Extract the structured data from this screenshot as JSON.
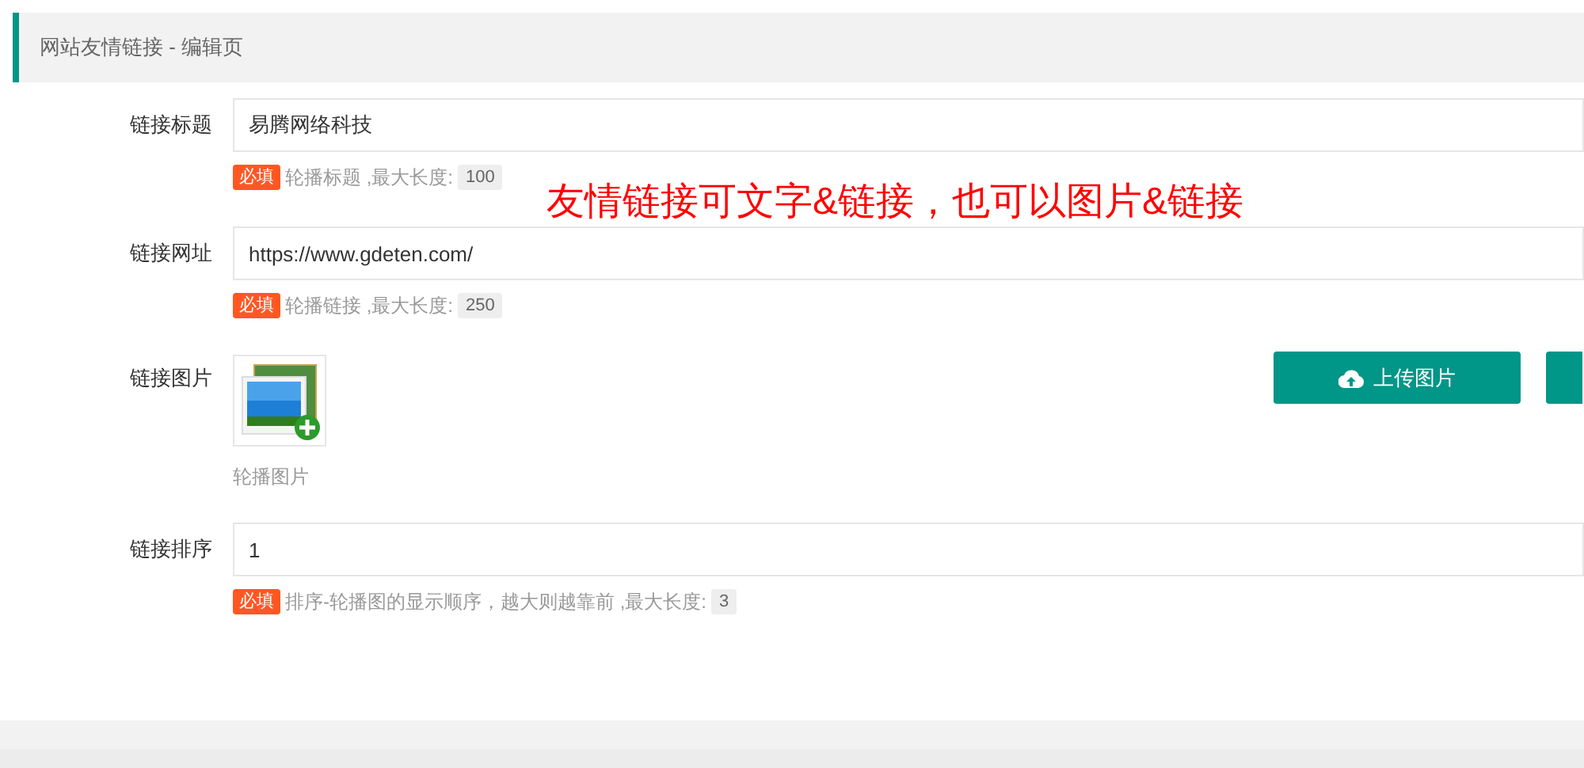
{
  "header": {
    "title": "网站友情链接 - 编辑页"
  },
  "annotation": "友情链接可文字&链接，也可以图片&链接",
  "fields": [
    {
      "kind": "text",
      "label": "链接标题",
      "value": "易腾网络科技",
      "badge": "必填",
      "hint": "轮播标题 ,最大长度:",
      "max": "100"
    },
    {
      "kind": "text",
      "label": "链接网址",
      "value": "https://www.gdeten.com/",
      "badge": "必填",
      "hint": "轮播链接 ,最大长度:",
      "max": "250"
    },
    {
      "kind": "image",
      "label": "链接图片",
      "hint": "轮播图片",
      "buttons": [
        {
          "kind": "upload",
          "label": "上传图片"
        },
        {
          "kind": "blank"
        }
      ]
    },
    {
      "kind": "text",
      "label": "链接排序",
      "value": "1",
      "badge": "必填",
      "hint": "排序-轮播图的显示顺序，越大则越靠前 ,最大长度:",
      "max": "3"
    }
  ]
}
